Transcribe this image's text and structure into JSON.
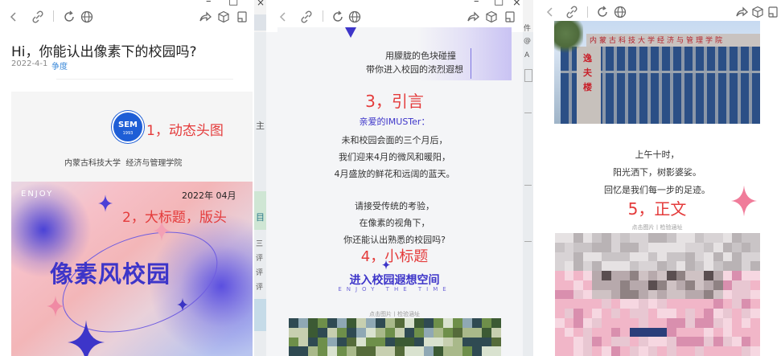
{
  "panel1": {
    "title": "Hi，你能认出像素下的校园吗?",
    "date": "2022-4-1",
    "author": "争度",
    "annotation_1": "1，动态头图",
    "logo_text": "SEM",
    "logo_year": "1993",
    "school": "内蒙古科技大学  经济与管理学院",
    "banner_enjoy": "ENJOY",
    "banner_date": "2022年 04月",
    "annotation_2": "2，大标题，版头",
    "banner_title": "像素风校园"
  },
  "panel2": {
    "top_line_1": "用朦胧的色块碰撞",
    "top_line_2": "带你进入校园的浓烈遐想",
    "annotation_3": "3，引言",
    "greeting": "亲爱的IMUSTer：",
    "para1": [
      "未和校园会面的三个月后，",
      "我们迎来4月的微风和暖阳，",
      "4月盛放的鲜花和远阔的蓝天。"
    ],
    "para2": [
      "请接受传统的考验，",
      "在像素的视角下，",
      "你还能认出熟悉的校园吗?"
    ],
    "annotation_4": "4，小标题",
    "subtitle": "进入校园遐想空间",
    "subtitle_en": "ENJOY THE TIME",
    "caption": "点击图片丨检验涵址"
  },
  "panel3": {
    "building_sign": "逸夫楼",
    "roof_text": "内蒙古科技大学经济与管理学院",
    "lines": [
      "上午十时，",
      "阳光洒下，树影婆娑。",
      "回忆是我们每一步的足迹。"
    ],
    "annotation_5": "5，正文",
    "caption": "点击图片丨检验涵址"
  },
  "gap1": {
    "side_text": "主",
    "bottom_items": [
      "三",
      "评",
      "评",
      "评"
    ],
    "mid_text": "目"
  },
  "gap2": {
    "side_items": [
      "件",
      "@",
      "A"
    ]
  },
  "colors": {
    "accent_red": "#e43b3b",
    "purple": "#3d35c9",
    "link_blue": "#3a88d8"
  }
}
